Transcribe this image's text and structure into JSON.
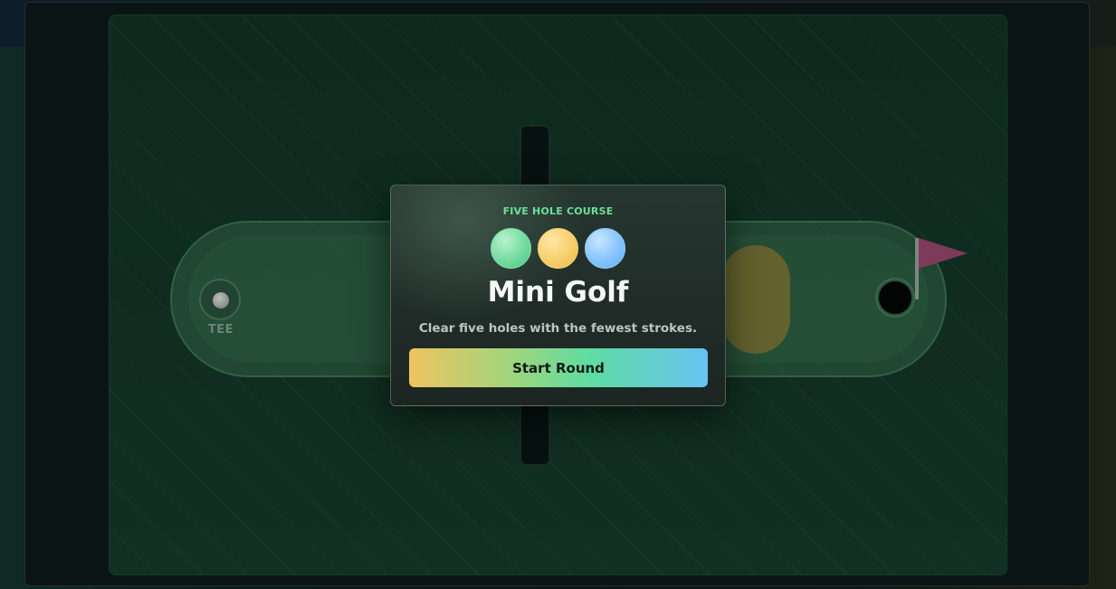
{
  "course": {
    "tee_label": "TEE"
  },
  "modal": {
    "kicker": "FIVE HOLE COURSE",
    "title": "Mini Golf",
    "subtitle": "Clear five holes with the fewest strokes.",
    "start_button": "Start Round",
    "ball_colors": [
      "#74dba0",
      "#f8cf6c",
      "#86c4ff"
    ]
  },
  "colors": {
    "accent_green": "#6ddf9a",
    "flag": "#7d3a5b",
    "sand": "#78682c"
  }
}
